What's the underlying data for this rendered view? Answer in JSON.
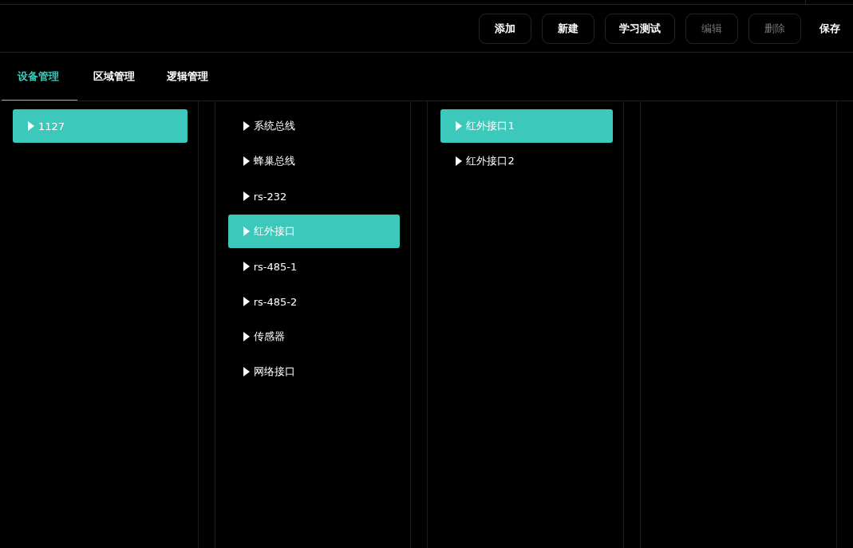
{
  "toolbar": {
    "buttons": [
      {
        "label": "添加",
        "kind": "outlined",
        "disabled": false
      },
      {
        "label": "新建",
        "kind": "outlined",
        "disabled": false
      },
      {
        "label": "学习测试",
        "kind": "outlined",
        "disabled": false
      },
      {
        "label": "编辑",
        "kind": "outlined",
        "disabled": true
      },
      {
        "label": "删除",
        "kind": "outlined",
        "disabled": true
      },
      {
        "label": "保存",
        "kind": "plain",
        "disabled": false
      }
    ]
  },
  "tabs": [
    {
      "label": "设备管理",
      "selected": true
    },
    {
      "label": "区域管理",
      "selected": false
    },
    {
      "label": "逻辑管理",
      "selected": false
    }
  ],
  "columns": [
    {
      "items": [
        {
          "label": "1127",
          "selected": true
        }
      ]
    },
    {
      "items": [
        {
          "label": "系统总线",
          "selected": false
        },
        {
          "label": "蜂巢总线",
          "selected": false
        },
        {
          "label": "rs-232",
          "selected": false
        },
        {
          "label": "红外接口",
          "selected": true
        },
        {
          "label": "rs-485-1",
          "selected": false
        },
        {
          "label": "rs-485-2",
          "selected": false
        },
        {
          "label": "传感器",
          "selected": false
        },
        {
          "label": "网络接口",
          "selected": false
        }
      ]
    },
    {
      "items": [
        {
          "label": "红外接口1",
          "selected": true
        },
        {
          "label": "红外接口2",
          "selected": false
        }
      ]
    }
  ]
}
